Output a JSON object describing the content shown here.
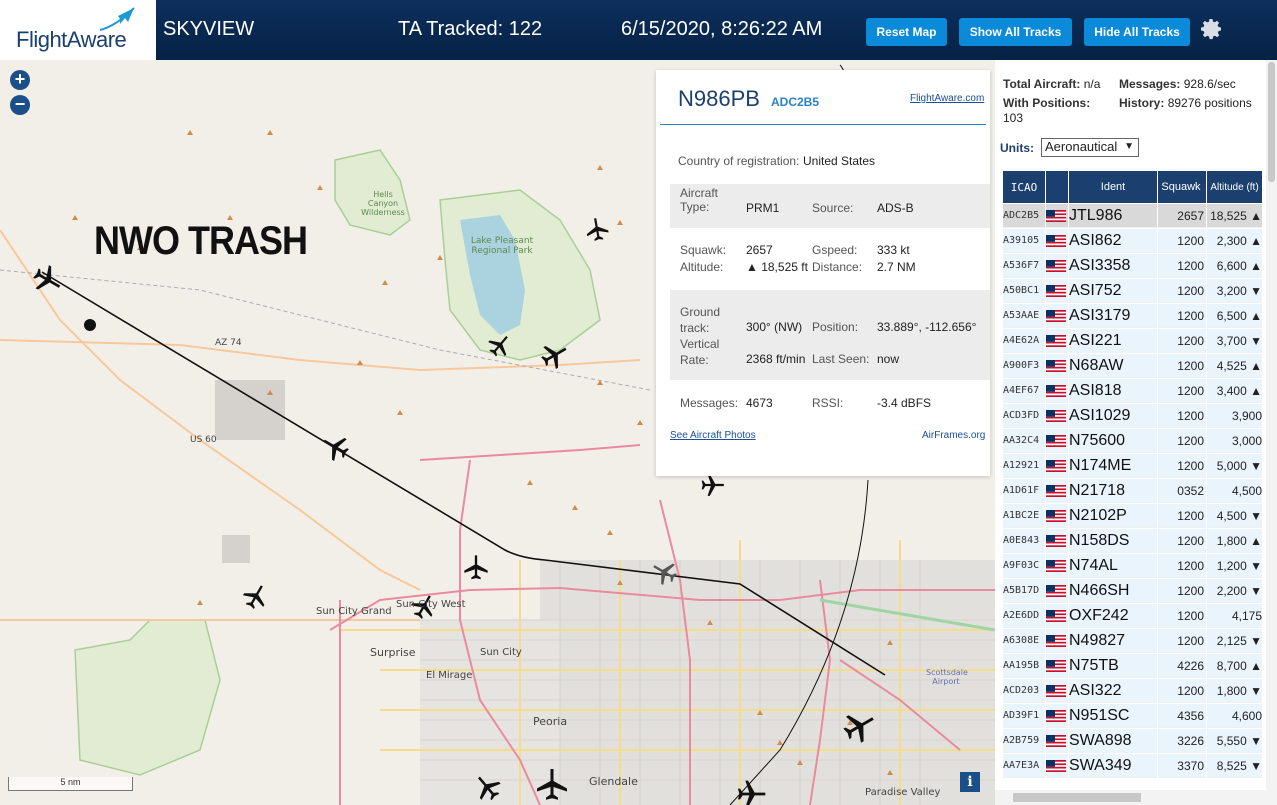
{
  "header": {
    "logo": "FlightAware",
    "app_name": "SKYVIEW",
    "tracked": "TA Tracked: 122",
    "datetime": "6/15/2020, 8:26:22 AM",
    "reset_map": "Reset Map",
    "show_all_tracks": "Show All Tracks",
    "hide_all_tracks": "Hide All Tracks"
  },
  "map": {
    "zoom_in": "+",
    "zoom_out": "−",
    "overlay_text": "NWO TRASH",
    "scale": "5 nm",
    "info": "i",
    "labels": [
      "Hells Canyon Wilderness",
      "Lake Pleasant Regional Park",
      "AZ 74",
      "US 60",
      "Sun City Grand",
      "Sun City West",
      "Surprise",
      "Sun City",
      "El Mirage",
      "Peoria",
      "Glendale",
      "Scottsdale Airport",
      "Paradise Valley"
    ]
  },
  "popup": {
    "callsign": "N986PB",
    "hex": "ADC2B5",
    "fa_link": "FlightAware.com",
    "country_label": "Country of registration:",
    "country": "United States",
    "aircraft_type_label": "Aircraft Type:",
    "aircraft_type": "PRM1",
    "source_label": "Source:",
    "source": "ADS-B",
    "squawk_label": "Squawk:",
    "squawk": "2657",
    "gspeed_label": "Gspeed:",
    "gspeed": "333 kt",
    "altitude_label": "Altitude:",
    "altitude": "▲ 18,525 ft",
    "distance_label": "Distance:",
    "distance": "2.7 NM",
    "ground_track_label": "Ground track:",
    "ground_track": "300° (NW)",
    "position_label": "Position:",
    "position": "33.889°, -112.656°",
    "vertical_rate_label": "Vertical Rate:",
    "vertical_rate": "2368 ft/min",
    "last_seen_label": "Last Seen:",
    "last_seen": "now",
    "messages_label": "Messages:",
    "messages": "4673",
    "rssi_label": "RSSI:",
    "rssi": "-3.4 dBFS",
    "photos_link": "See Aircraft Photos",
    "airframes_link": "AirFrames.org"
  },
  "side": {
    "total_aircraft_label": "Total Aircraft:",
    "total_aircraft": "n/a",
    "messages_label": "Messages:",
    "messages": "928.6/sec",
    "with_positions_label": "With Positions:",
    "with_positions": "103",
    "history_label": "History:",
    "history": "89276 positions",
    "units_label": "Units:",
    "units_value": "Aeronautical",
    "columns": [
      "ICAO",
      "",
      "Ident",
      "Squawk",
      "Altitude (ft)"
    ],
    "rows": [
      {
        "icao": "ADC2B5",
        "ident": "JTL986",
        "squawk": "2657",
        "alt": "18,525 ▲"
      },
      {
        "icao": "A39105",
        "ident": "ASI862",
        "squawk": "1200",
        "alt": "2,300 ▲"
      },
      {
        "icao": "A536F7",
        "ident": "ASI3358",
        "squawk": "1200",
        "alt": "6,600 ▲"
      },
      {
        "icao": "A50BC1",
        "ident": "ASI752",
        "squawk": "1200",
        "alt": "3,200 ▼"
      },
      {
        "icao": "A53AAE",
        "ident": "ASI3179",
        "squawk": "1200",
        "alt": "6,500 ▲"
      },
      {
        "icao": "A4E62A",
        "ident": "ASI221",
        "squawk": "1200",
        "alt": "3,700 ▼"
      },
      {
        "icao": "A900F3",
        "ident": "N68AW",
        "squawk": "1200",
        "alt": "4,525 ▲"
      },
      {
        "icao": "A4EF67",
        "ident": "ASI818",
        "squawk": "1200",
        "alt": "3,400 ▲"
      },
      {
        "icao": "ACD3FD",
        "ident": "ASI1029",
        "squawk": "1200",
        "alt": "3,900"
      },
      {
        "icao": "AA32C4",
        "ident": "N75600",
        "squawk": "1200",
        "alt": "3,000"
      },
      {
        "icao": "A12921",
        "ident": "N174ME",
        "squawk": "1200",
        "alt": "5,000 ▼"
      },
      {
        "icao": "A1D61F",
        "ident": "N21718",
        "squawk": "0352",
        "alt": "4,500"
      },
      {
        "icao": "A1BC2E",
        "ident": "N2102P",
        "squawk": "1200",
        "alt": "4,500 ▼"
      },
      {
        "icao": "A0E843",
        "ident": "N158DS",
        "squawk": "1200",
        "alt": "1,800 ▲"
      },
      {
        "icao": "A9F03C",
        "ident": "N74AL",
        "squawk": "1200",
        "alt": "1,200 ▼"
      },
      {
        "icao": "A5B17D",
        "ident": "N466SH",
        "squawk": "1200",
        "alt": "2,200 ▼"
      },
      {
        "icao": "A2E6DD",
        "ident": "OXF242",
        "squawk": "1200",
        "alt": "4,175"
      },
      {
        "icao": "A6308E",
        "ident": "N49827",
        "squawk": "1200",
        "alt": "2,125 ▼"
      },
      {
        "icao": "AA195B",
        "ident": "N75TB",
        "squawk": "4226",
        "alt": "8,700 ▲"
      },
      {
        "icao": "ACD203",
        "ident": "ASI322",
        "squawk": "1200",
        "alt": "1,800 ▼"
      },
      {
        "icao": "AD39F1",
        "ident": "N951SC",
        "squawk": "4356",
        "alt": "4,600"
      },
      {
        "icao": "A2B759",
        "ident": "SWA898",
        "squawk": "3226",
        "alt": "5,550 ▼"
      },
      {
        "icao": "AA7E3A",
        "ident": "SWA349",
        "squawk": "3370",
        "alt": "8,525 ▼"
      }
    ]
  }
}
